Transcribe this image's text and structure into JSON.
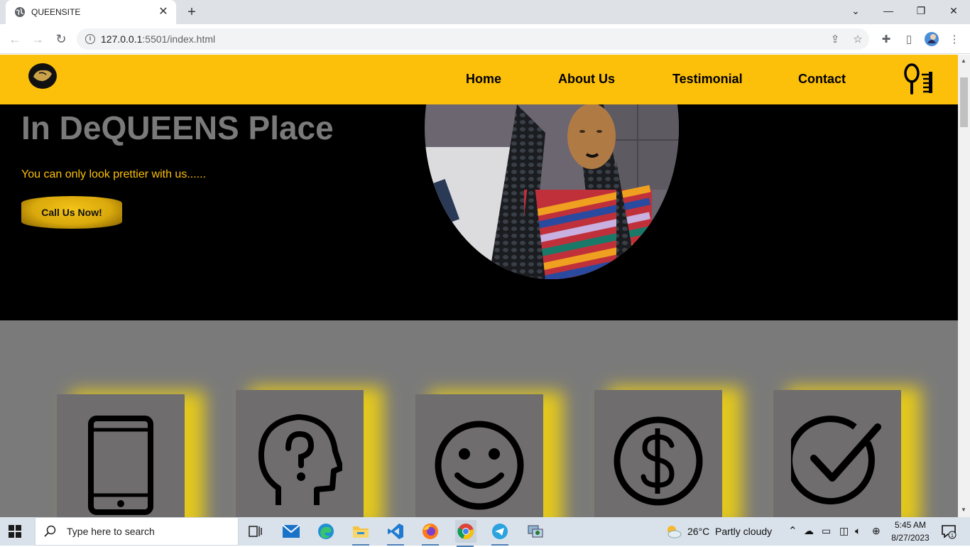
{
  "browser": {
    "tab_title": "QUEENSITE",
    "url_host": "127.0.0.1",
    "url_rest": ":5501/index.html"
  },
  "site": {
    "nav": {
      "links": [
        "Home",
        "About Us",
        "Testimonial",
        "Contact"
      ]
    },
    "hero": {
      "title": "In DeQUEENS Place",
      "tagline": "You can only look prettier with us......",
      "cta_label": "Call Us Now!"
    },
    "features": {
      "icons": [
        "phone-icon",
        "head-question-icon",
        "smiley-icon",
        "dollar-icon",
        "check-circle-icon"
      ]
    },
    "colors": {
      "brand_yellow": "#fcc00a",
      "hero_bg": "#000000",
      "section_gray": "#7a7a7a",
      "card_gray": "#6f6d6e"
    }
  },
  "taskbar": {
    "search_placeholder": "Type here to search",
    "weather_temp": "26°C",
    "weather_text": "Partly cloudy",
    "time": "5:45 AM",
    "date": "8/27/2023",
    "notification_count": "1"
  }
}
